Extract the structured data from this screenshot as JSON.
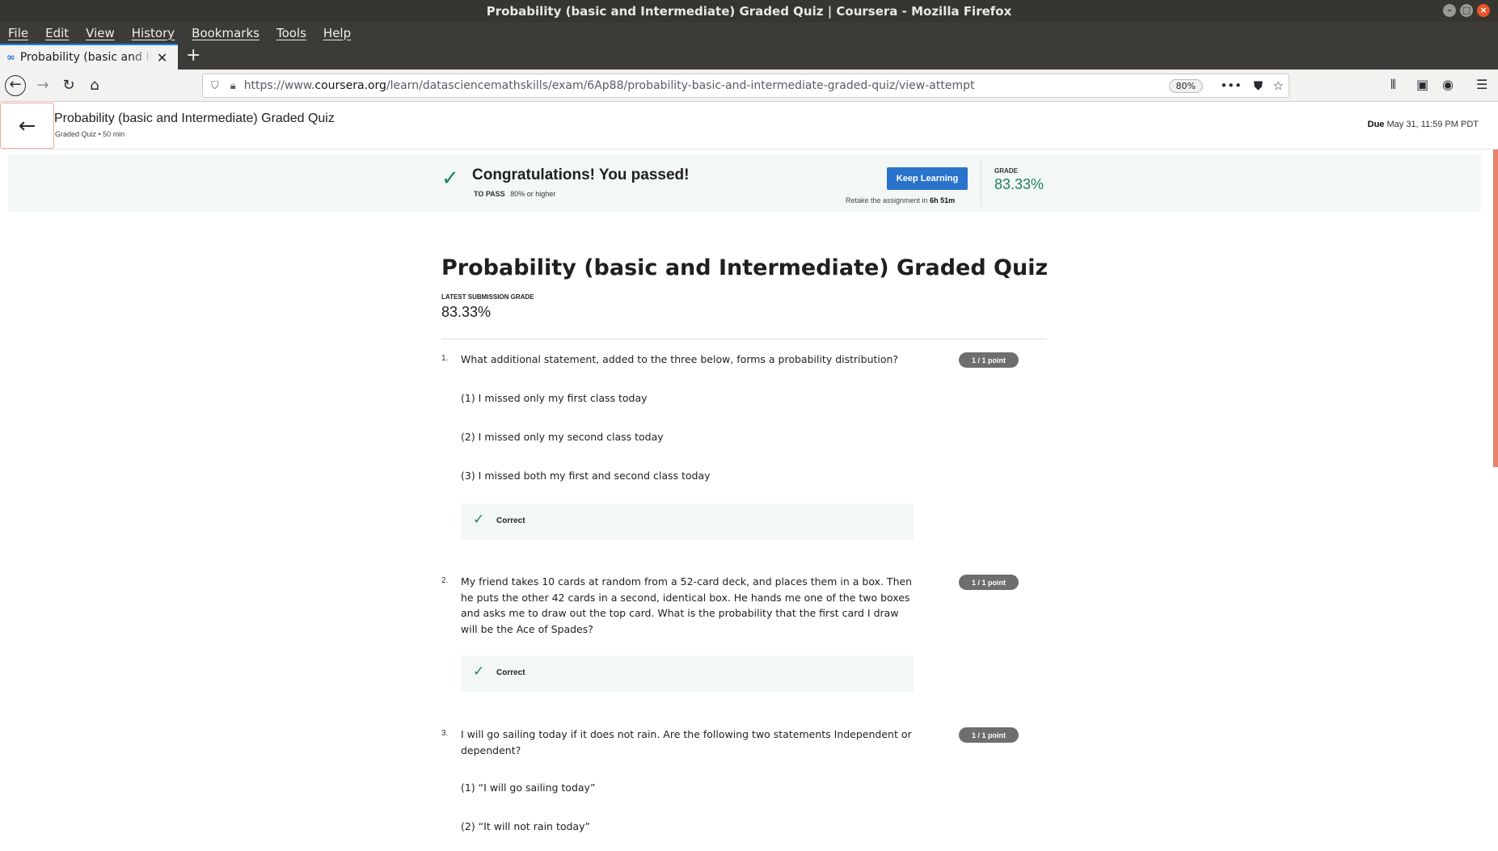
{
  "window": {
    "title": "Probability (basic and Intermediate) Graded Quiz | Coursera - Mozilla Firefox"
  },
  "menu": [
    "File",
    "Edit",
    "View",
    "History",
    "Bookmarks",
    "Tools",
    "Help"
  ],
  "tab": {
    "title": "Probability (basic and Intermediate) Graded Quiz"
  },
  "browser": {
    "url_prefix": "https://www.",
    "url_domain": "coursera.org",
    "url_path": "/learn/datasciencemathskills/exam/6Ap88/probability-basic-and-intermediate-graded-quiz/view-attempt",
    "zoom": "80%"
  },
  "header": {
    "title": "Probability (basic and Intermediate) Graded Quiz",
    "subtitle": "Graded Quiz • 50 min",
    "due_label": "Due",
    "due_value": "May 31, 11:59 PM PDT"
  },
  "banner": {
    "message": "Congratulations! You passed!",
    "to_pass_label": "TO PASS",
    "to_pass_value": "80% or higher",
    "button": "Keep Learning",
    "retake_prefix": "Retake the assignment in",
    "retake_time": "6h 51m",
    "grade_label": "GRADE",
    "grade_value": "83.33%"
  },
  "quiz": {
    "title": "Probability (basic and Intermediate) Graded Quiz",
    "latest_label": "LATEST SUBMISSION GRADE",
    "latest_value": "83.33%",
    "questions": [
      {
        "number": "1.",
        "text": "What additional statement, added to the three below, forms a probability distribution?",
        "points": "1 / 1 point",
        "options": [
          "(1) I missed only my first class today",
          "(2) I missed only my second class today",
          "(3) I missed both my first and second class today"
        ],
        "feedback": "Correct"
      },
      {
        "number": "2.",
        "text": "My friend takes 10 cards at random from a 52-card deck, and places them in a box. Then he puts the other 42 cards in a second, identical box. He hands me one of the two boxes and asks me to draw out the top card. What is the probability that the first card I draw will be the Ace of Spades?",
        "points": "1 / 1 point",
        "feedback": "Correct"
      },
      {
        "number": "3.",
        "text": "I will go sailing today if it does not rain. Are the following two statements Independent or dependent?",
        "points": "1 / 1 point",
        "options": [
          "(1) “I will go sailing today”",
          "(2) “It will not rain today”"
        ]
      }
    ]
  }
}
